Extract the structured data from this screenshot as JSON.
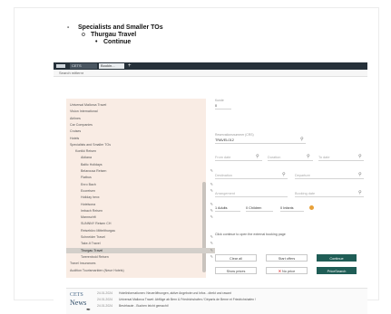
{
  "outline": {
    "level1": "Specialists and Smaller TOs",
    "level2": "Thurgau Travel",
    "level3": "Continue"
  },
  "app": {
    "tabs": [
      "CETS",
      "Bookin..."
    ],
    "tab_add": "+",
    "search_label": "Search mitlernr"
  },
  "sidebar": {
    "items": [
      {
        "label": "Universal Mallorca Travel",
        "level": 0
      },
      {
        "label": "Vision International",
        "level": 0
      },
      {
        "label": "Airlines",
        "level": 0
      },
      {
        "label": "Car Companies",
        "level": 0
      },
      {
        "label": "Cruises",
        "level": 0
      },
      {
        "label": "Hotels",
        "level": 0
      },
      {
        "label": "Specialists and Smaller TOs",
        "level": 0
      },
      {
        "label": "Kontiki Reisen",
        "level": 1
      },
      {
        "label": "Aldiana",
        "level": 2
      },
      {
        "label": "Baltic Holidays",
        "level": 2
      },
      {
        "label": "Belarousa Reisen",
        "level": 2,
        "edit": true
      },
      {
        "label": "Flatbus",
        "level": 2
      },
      {
        "label": "Enro Bach",
        "level": 2,
        "edit": true
      },
      {
        "label": "Ecoreisen",
        "level": 2,
        "edit": true
      },
      {
        "label": "Holiday hexx",
        "level": 2
      },
      {
        "label": "Hotelsona",
        "level": 2,
        "edit": true
      },
      {
        "label": "Imbach Reisen",
        "level": 2,
        "edit": true
      },
      {
        "label": "Mannschft",
        "level": 2,
        "edit": true
      },
      {
        "label": "SUNNNY Reisen CH",
        "level": 2
      },
      {
        "label": "Reisebüro Mittelthurgau",
        "level": 2
      },
      {
        "label": "Schneider Travel",
        "level": 2,
        "edit": true
      },
      {
        "label": "Take-It Travel",
        "level": 2,
        "edit": true
      },
      {
        "label": "Thurgau Travel",
        "level": 2,
        "edit": true,
        "selected": true
      },
      {
        "label": "Twerenbold Reisen",
        "level": 2,
        "edit": true
      },
      {
        "label": "Travel Insurances",
        "level": 0
      },
      {
        "label": "Audition Tourismarkten (Neue Hotels)",
        "level": 0
      }
    ]
  },
  "form": {
    "top_label": "Kunde",
    "top_value": "0",
    "agency_label": "Reservationsnummer (CRS)",
    "agency_value": "TRAVEL012",
    "from_date": "From date",
    "duration": "Duration",
    "to_date": "To date",
    "destination": "Destination",
    "departure": "Departure",
    "arrangement": "Arrangement",
    "booking_date": "Booking date",
    "travellers": [
      "1 Adults",
      "0 Children",
      "0 Infants"
    ],
    "message": "Click continue to open the external booking page",
    "buttons": {
      "clear_all": "Clear all",
      "start_offer": "Start offers",
      "continue": "Continue",
      "show_prices": "Show prices",
      "no_price": "No price",
      "price_search": "PriceSearch"
    }
  },
  "news": {
    "logo_top": "CETS",
    "logo_bottom": "News",
    "items": [
      {
        "date": "24.01.2024",
        "text": "Hotelinformationen: Neueröffnungen, aktive Angebote und Infos - direkt und rasant"
      },
      {
        "date": "24.01.2024",
        "text": "Universal Mallorca Travel: Abflüge ab Bern & Friedrichshafen / Départs de Berne et Friedrichshafen !"
      },
      {
        "date": "24.01.2024",
        "text": "Bestrhaute - Buchen leicht gemacht!"
      }
    ]
  }
}
